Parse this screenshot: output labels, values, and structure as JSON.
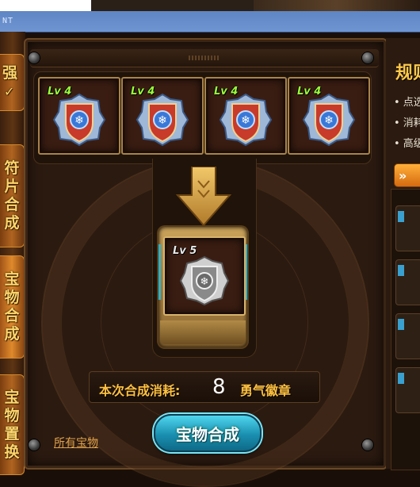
{
  "window": {
    "title_fragment": "NT"
  },
  "left_nav": {
    "tab1": "强",
    "tab1_glyph": "✓",
    "tab2": [
      "符",
      "片",
      "合",
      "成"
    ],
    "tab3": [
      "宝",
      "物",
      "合",
      "成"
    ],
    "tab4": [
      "宝",
      "物",
      "置",
      "换"
    ]
  },
  "synthesis": {
    "input_slots": [
      {
        "level": "Lv 4",
        "item": "courage-badge"
      },
      {
        "level": "Lv 4",
        "item": "courage-badge"
      },
      {
        "level": "Lv 4",
        "item": "courage-badge"
      },
      {
        "level": "Lv 4",
        "item": "courage-badge"
      }
    ],
    "result": {
      "level": "Lv 5",
      "item": "courage-badge-silver"
    },
    "cost_label": "本次合成消耗:",
    "cost_value": "8",
    "cost_unit": "勇气徽章",
    "button_label": "宝物合成",
    "all_treasures_link": "所有宝物"
  },
  "rules_panel": {
    "title": "规则",
    "lines": [
      "• 点选",
      "• 消耗",
      "• 高级"
    ],
    "expand_label": "»"
  },
  "colors": {
    "level_green": "#9bff3a",
    "gold_text": "#ffc040",
    "button_cyan": "#1a8fb0"
  }
}
